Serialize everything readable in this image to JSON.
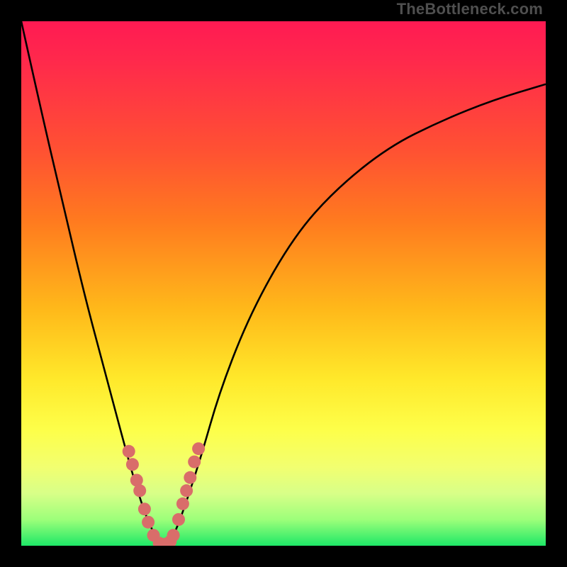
{
  "watermark": "TheBottleneck.com",
  "colors": {
    "frame": "#000000",
    "gradient_top": "#ff1a53",
    "gradient_mid": "#ffe82a",
    "gradient_bottom": "#1ee867",
    "curve": "#000000",
    "marker": "#d96d6a"
  },
  "chart_data": {
    "type": "line",
    "title": "",
    "xlabel": "",
    "ylabel": "",
    "xlim": [
      0,
      100
    ],
    "ylim": [
      0,
      100
    ],
    "series": [
      {
        "name": "bottleneck-curve",
        "x": [
          0,
          4,
          8,
          12,
          16,
          20,
          22,
          24,
          26,
          28,
          30,
          34,
          38,
          44,
          52,
          60,
          70,
          80,
          90,
          100
        ],
        "y": [
          100,
          82,
          65,
          48,
          33,
          18,
          11,
          5,
          1,
          0,
          4,
          16,
          30,
          45,
          59,
          68,
          76,
          81,
          85,
          88
        ]
      }
    ],
    "markers": [
      {
        "x": 20.5,
        "y": 18
      },
      {
        "x": 21.2,
        "y": 15.5
      },
      {
        "x": 22.0,
        "y": 12.5
      },
      {
        "x": 22.6,
        "y": 10.5
      },
      {
        "x": 23.5,
        "y": 7
      },
      {
        "x": 24.2,
        "y": 4.5
      },
      {
        "x": 25.2,
        "y": 2
      },
      {
        "x": 26.3,
        "y": 0.5
      },
      {
        "x": 27.4,
        "y": 0.3
      },
      {
        "x": 28.4,
        "y": 0.8
      },
      {
        "x": 29.0,
        "y": 2
      },
      {
        "x": 30.0,
        "y": 5
      },
      {
        "x": 30.8,
        "y": 8
      },
      {
        "x": 31.5,
        "y": 10.5
      },
      {
        "x": 32.2,
        "y": 13
      },
      {
        "x": 33.0,
        "y": 16
      },
      {
        "x": 33.8,
        "y": 18.5
      }
    ]
  }
}
